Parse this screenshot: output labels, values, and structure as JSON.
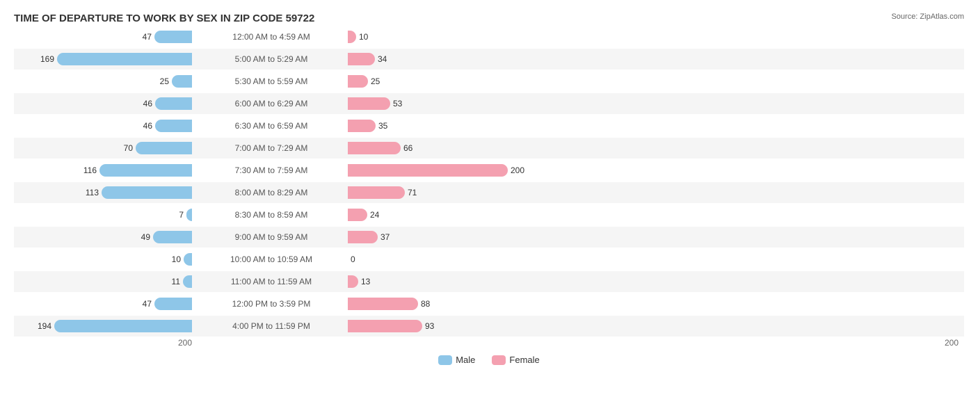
{
  "title": "TIME OF DEPARTURE TO WORK BY SEX IN ZIP CODE 59722",
  "source": "Source: ZipAtlas.com",
  "colors": {
    "male": "#8ec6e8",
    "female": "#f4a0b0",
    "alt_row": "#f5f5f5"
  },
  "axis": {
    "left_label": "200",
    "right_label": "200"
  },
  "legend": {
    "male_label": "Male",
    "female_label": "Female"
  },
  "rows": [
    {
      "label": "12:00 AM to 4:59 AM",
      "male": 47,
      "female": 10,
      "alt": false
    },
    {
      "label": "5:00 AM to 5:29 AM",
      "male": 169,
      "female": 34,
      "alt": true
    },
    {
      "label": "5:30 AM to 5:59 AM",
      "male": 25,
      "female": 25,
      "alt": false
    },
    {
      "label": "6:00 AM to 6:29 AM",
      "male": 46,
      "female": 53,
      "alt": true
    },
    {
      "label": "6:30 AM to 6:59 AM",
      "male": 46,
      "female": 35,
      "alt": false
    },
    {
      "label": "7:00 AM to 7:29 AM",
      "male": 70,
      "female": 66,
      "alt": true
    },
    {
      "label": "7:30 AM to 7:59 AM",
      "male": 116,
      "female": 200,
      "alt": false
    },
    {
      "label": "8:00 AM to 8:29 AM",
      "male": 113,
      "female": 71,
      "alt": true
    },
    {
      "label": "8:30 AM to 8:59 AM",
      "male": 7,
      "female": 24,
      "alt": false
    },
    {
      "label": "9:00 AM to 9:59 AM",
      "male": 49,
      "female": 37,
      "alt": true
    },
    {
      "label": "10:00 AM to 10:59 AM",
      "male": 10,
      "female": 0,
      "alt": false
    },
    {
      "label": "11:00 AM to 11:59 AM",
      "male": 11,
      "female": 13,
      "alt": true
    },
    {
      "label": "12:00 PM to 3:59 PM",
      "male": 47,
      "female": 88,
      "alt": false
    },
    {
      "label": "4:00 PM to 11:59 PM",
      "male": 194,
      "female": 93,
      "alt": true
    }
  ],
  "max_value": 200
}
